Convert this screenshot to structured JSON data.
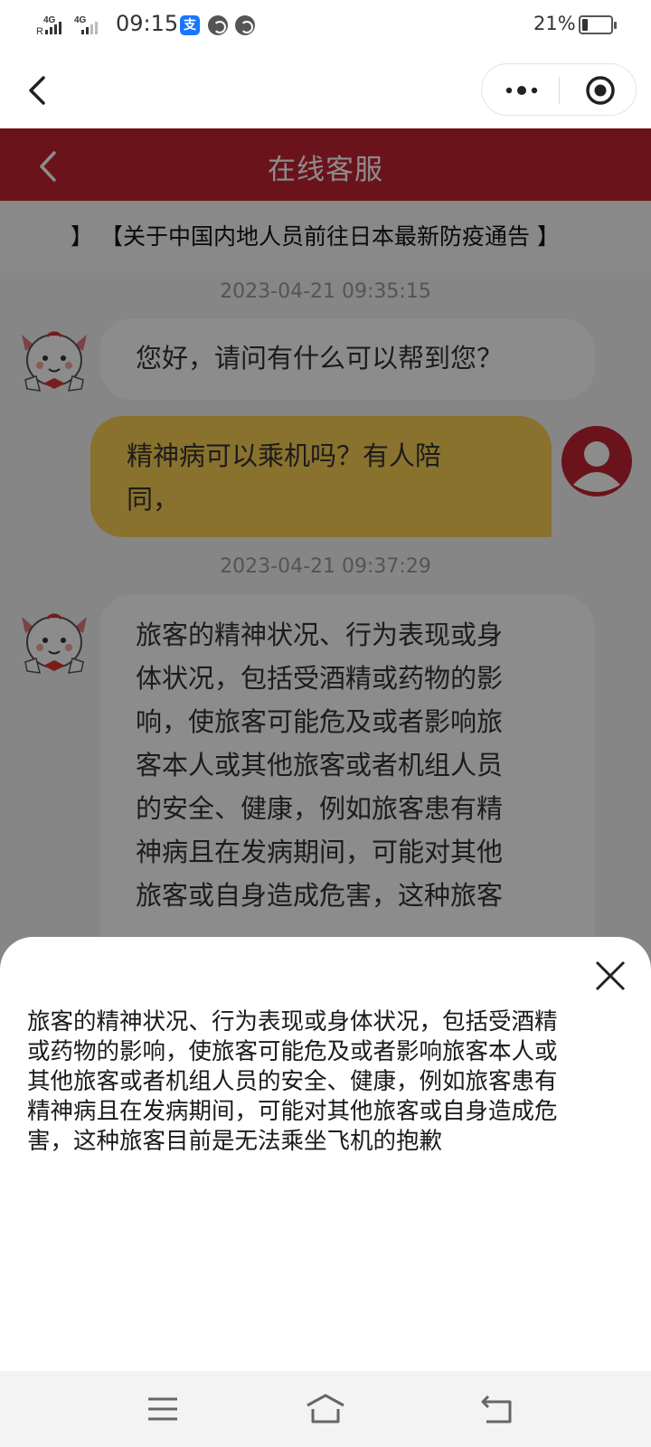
{
  "status_bar": {
    "network_1": "4G",
    "network_2": "4G",
    "roaming_mark": "R",
    "time": "09:15",
    "battery_percent_text": "21%",
    "battery_level": 0.21,
    "app_icons": [
      "alipay-icon",
      "notification-icon",
      "notification-icon"
    ]
  },
  "mini_program_bar": {
    "back_icon": "chevron-left-icon",
    "more_icon": "more-dots-icon",
    "close_icon": "target-circle-icon"
  },
  "header": {
    "title": "在线客服",
    "back_icon": "chevron-left-icon",
    "color": "#c42332"
  },
  "notice": {
    "text": "】   【关于中国内地人员前往日本最新防疫通告 】"
  },
  "messages": [
    {
      "type": "timestamp",
      "text": "2023-04-21 09:35:15"
    },
    {
      "type": "bot",
      "text": "您好，请问有什么可以帮到您？"
    },
    {
      "type": "user",
      "lines": [
        "精神病可以乘机吗？有人陪",
        "同，"
      ]
    },
    {
      "type": "timestamp",
      "text": "2023-04-21 09:37:29"
    },
    {
      "type": "bot",
      "lines": [
        "旅客的精神状况、行为表现或身",
        "体状况，包括受酒精或药物的影",
        "响，使旅客可能危及或者影响旅",
        "客本人或其他旅客或者机组人员",
        "的安全、健康，例如旅客患有精",
        "神病且在发病期间，可能对其他",
        "旅客或自身造成危害，这种旅客"
      ]
    }
  ],
  "sheet": {
    "close_icon": "close-x-icon",
    "lines": [
      "旅客的精神状况、行为表现或身体状况，包括受酒精",
      "或药物的影响，使旅客可能危及或者影响旅客本人或",
      "其他旅客或者机组人员的安全、健康，例如旅客患有",
      "精神病且在发病期间，可能对其他旅客或自身造成危",
      "害，这种旅客目前是无法乘坐飞机的抱歉"
    ]
  },
  "system_nav": {
    "menu_icon": "menu-lines-icon",
    "home_icon": "home-icon",
    "back_icon": "back-arrow-icon"
  }
}
